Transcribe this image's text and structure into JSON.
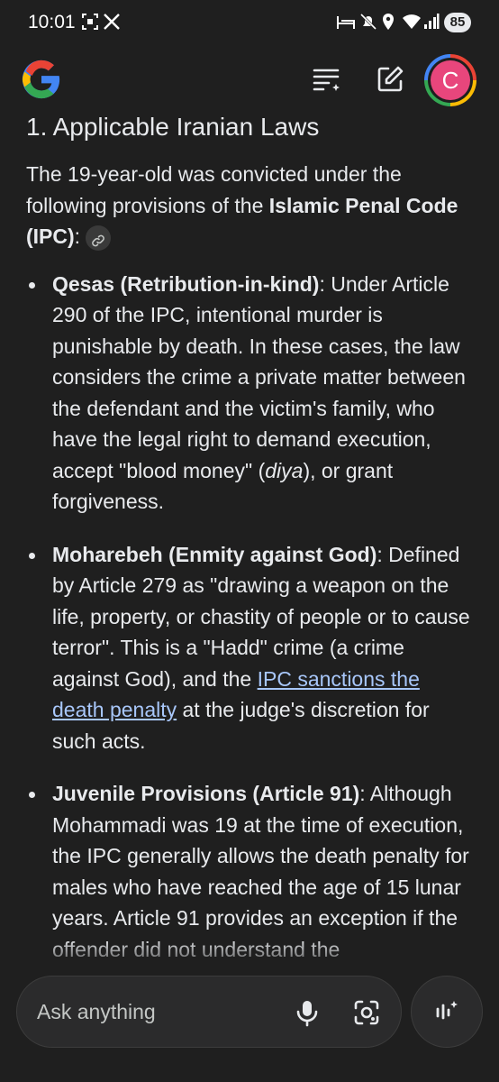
{
  "status_bar": {
    "time": "10:01",
    "battery": "85",
    "icons": [
      "screenshot-icon",
      "x-icon",
      "bed-icon",
      "mute-icon",
      "location-icon",
      "wifi-icon",
      "signal-icon",
      "battery-icon"
    ]
  },
  "header": {
    "logo": "google-g-icon",
    "actions": [
      "history-menu-icon",
      "new-chat-icon"
    ],
    "avatar_letter": "C"
  },
  "article": {
    "heading": "1. Applicable Iranian Laws",
    "intro_prefix": "The 19-year-old was convicted under the following provisions of the ",
    "intro_bold": "Islamic Penal Code (IPC)",
    "intro_suffix": ":",
    "items": [
      {
        "title": "Qesas (Retribution-in-kind)",
        "text1": ": Under Article 290 of the IPC, intentional murder is punishable by death. In these cases, the law considers the crime a private matter between the defendant and the victim's family, who have the legal right to demand execution, accept \"blood money\" (",
        "italic": "diya",
        "text2": "), or grant forgiveness."
      },
      {
        "title": "Moharebeh (Enmity against God)",
        "text1": ": Defined by Article 279 as \"drawing a weapon on the life, property, or chastity of people or to cause terror\". This is a \"Hadd\" crime (a crime against God), and the ",
        "link": "IPC sanctions the death penalty",
        "text2": " at the judge's discretion for such acts."
      },
      {
        "title": "Juvenile Provisions (Article 91)",
        "text1": ": Although Mohammadi was 19 at the time of execution, the IPC generally allows the death penalty for males who have reached the age of 15 lunar years. Article 91 provides an exception if the offender did not understand the"
      }
    ]
  },
  "composer": {
    "placeholder": "Ask anything"
  },
  "colors": {
    "background": "#1f1f1f",
    "text": "#e8eaed",
    "link": "#a8c7fa",
    "avatar": "#e8467c"
  }
}
